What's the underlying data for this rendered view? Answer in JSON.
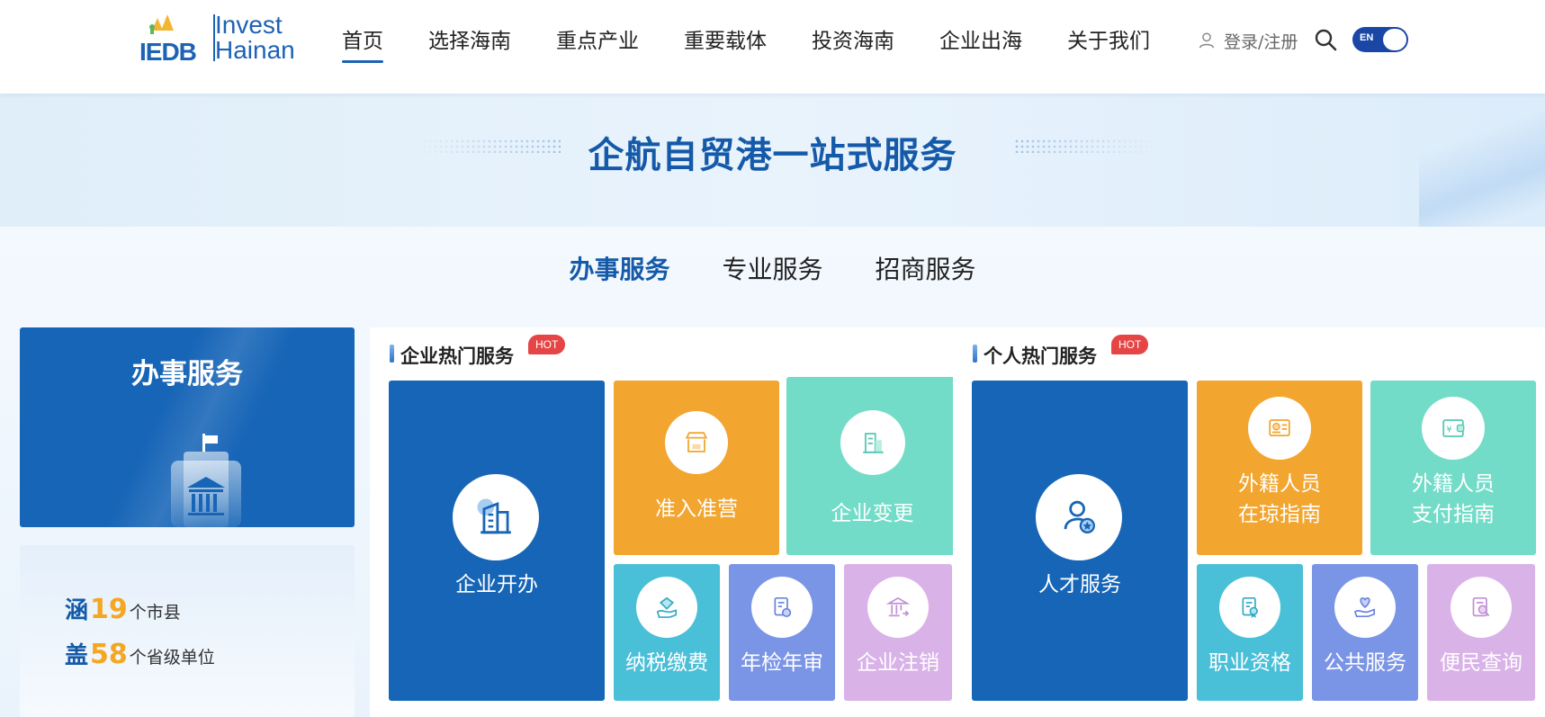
{
  "logo": {
    "abbr": "IEDB",
    "line1": "Invest",
    "line2": "Hainan"
  },
  "nav": [
    {
      "label": "首页",
      "active": true
    },
    {
      "label": "选择海南"
    },
    {
      "label": "重点产业"
    },
    {
      "label": "重要载体"
    },
    {
      "label": "投资海南"
    },
    {
      "label": "企业出海"
    },
    {
      "label": "关于我们"
    }
  ],
  "header": {
    "login_label": "登录/注册",
    "lang_label": "EN"
  },
  "banner": {
    "title": "企航自贸港一站式服务"
  },
  "tabs": [
    {
      "label": "办事服务",
      "active": true
    },
    {
      "label": "专业服务"
    },
    {
      "label": "招商服务"
    }
  ],
  "side": {
    "title": "办事服务",
    "stats": [
      {
        "prefix": "涵",
        "number": "19",
        "suffix": "个市县"
      },
      {
        "prefix": "盖",
        "number": "58",
        "suffix": "个省级单位"
      }
    ]
  },
  "enterprise": {
    "title": "企业热门服务",
    "badge": "HOT",
    "tiles": {
      "open": "企业开办",
      "access": "准入准营",
      "change": "企业变更",
      "tax": "纳税缴费",
      "annual": "年检年审",
      "cancel": "企业注销"
    }
  },
  "personal": {
    "title": "个人热门服务",
    "badge": "HOT",
    "tiles": {
      "talent": "人才服务",
      "foreign_line1": "外籍人员",
      "foreign_line2": "在琼指南",
      "pay_line1": "外籍人员",
      "pay_line2": "支付指南",
      "qualification": "职业资格",
      "public": "公共服务",
      "query": "便民查询"
    }
  },
  "colors": {
    "brand_blue": "#1765b7",
    "orange": "#f2a52f",
    "teal": "#73dcc8",
    "cyan": "#49bfd8",
    "purple": "#7b95e6",
    "pink": "#d9b2e8",
    "hot_red": "#e64545",
    "stat_number": "#f5a623"
  }
}
